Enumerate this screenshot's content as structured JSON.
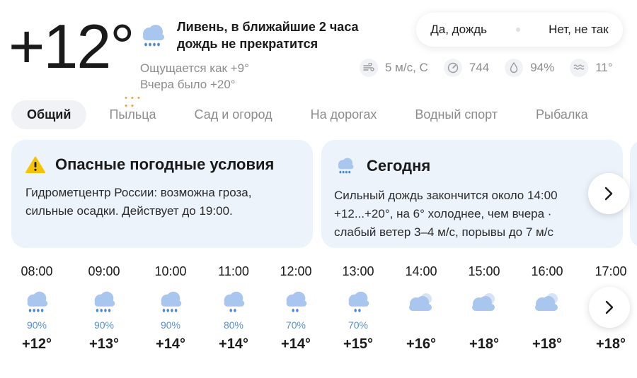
{
  "current": {
    "temperature": "+12°",
    "condition": "Ливень, в ближайшие 2 часа дождь не прекратится",
    "condition_line1": "Ливень, в ближайшие 2 часа",
    "condition_line2": "дождь не прекратится",
    "condition_icon": "rain-cloud-icon",
    "feels_like": "Ощущается как +9°",
    "yesterday": "Вчера было +20°"
  },
  "feedback": {
    "yes_label": "Да, дождь",
    "no_label": "Нет, не так"
  },
  "metrics": {
    "wind": {
      "icon": "wind-icon",
      "value": "5 м/с, С"
    },
    "pressure": {
      "icon": "gauge-icon",
      "value": "744"
    },
    "humidity": {
      "icon": "droplet-icon",
      "value": "94%"
    },
    "water": {
      "icon": "waves-icon",
      "value": "11°"
    }
  },
  "tabs": [
    {
      "label": "Общий",
      "active": true
    },
    {
      "label": "Пыльца",
      "active": false
    },
    {
      "label": "Сад и огород",
      "active": false
    },
    {
      "label": "На дорогах",
      "active": false
    },
    {
      "label": "Водный спорт",
      "active": false
    },
    {
      "label": "Рыбалка",
      "active": false
    }
  ],
  "cards": {
    "warning": {
      "icon": "warning-icon",
      "title": "Опасные погодные условия",
      "line1": "Гидрометцентр России: возможна гроза,",
      "line2": "сильные осадки. Действует до 19:00."
    },
    "today": {
      "icon": "rain-cloud-icon",
      "title": "Сегодня",
      "line1": "Сильный дождь закончится около 14:00",
      "line2": "+12...+20°, на 6° холоднее, чем вчера ·",
      "line3": "слабый ветер 3–4 м/с, порывы до 7 м/с"
    }
  },
  "hourly": [
    {
      "time": "08:00",
      "icon": "rain-cloud-icon",
      "prob": "90%",
      "temp": "+12°"
    },
    {
      "time": "09:00",
      "icon": "rain-cloud-icon",
      "prob": "90%",
      "temp": "+13°"
    },
    {
      "time": "10:00",
      "icon": "rain-cloud-icon",
      "prob": "90%",
      "temp": "+14°"
    },
    {
      "time": "11:00",
      "icon": "light-rain-cloud-icon",
      "prob": "80%",
      "temp": "+14°"
    },
    {
      "time": "12:00",
      "icon": "light-rain-cloud-icon",
      "prob": "70%",
      "temp": "+14°"
    },
    {
      "time": "13:00",
      "icon": "light-rain-cloud-icon",
      "prob": "70%",
      "temp": "+15°"
    },
    {
      "time": "14:00",
      "icon": "overcast-icon",
      "prob": "",
      "temp": "+16°"
    },
    {
      "time": "15:00",
      "icon": "overcast-icon",
      "prob": "",
      "temp": "+18°"
    },
    {
      "time": "16:00",
      "icon": "overcast-icon",
      "prob": "",
      "temp": "+18°"
    },
    {
      "time": "17:00",
      "icon": "overcast-icon",
      "prob": "",
      "temp": "+18°"
    }
  ],
  "colors": {
    "card_bg": "#edf3fb",
    "tab_active_bg": "#f0f2f5",
    "precip_prob": "#5a8fd6",
    "warning": "#f5c400"
  }
}
